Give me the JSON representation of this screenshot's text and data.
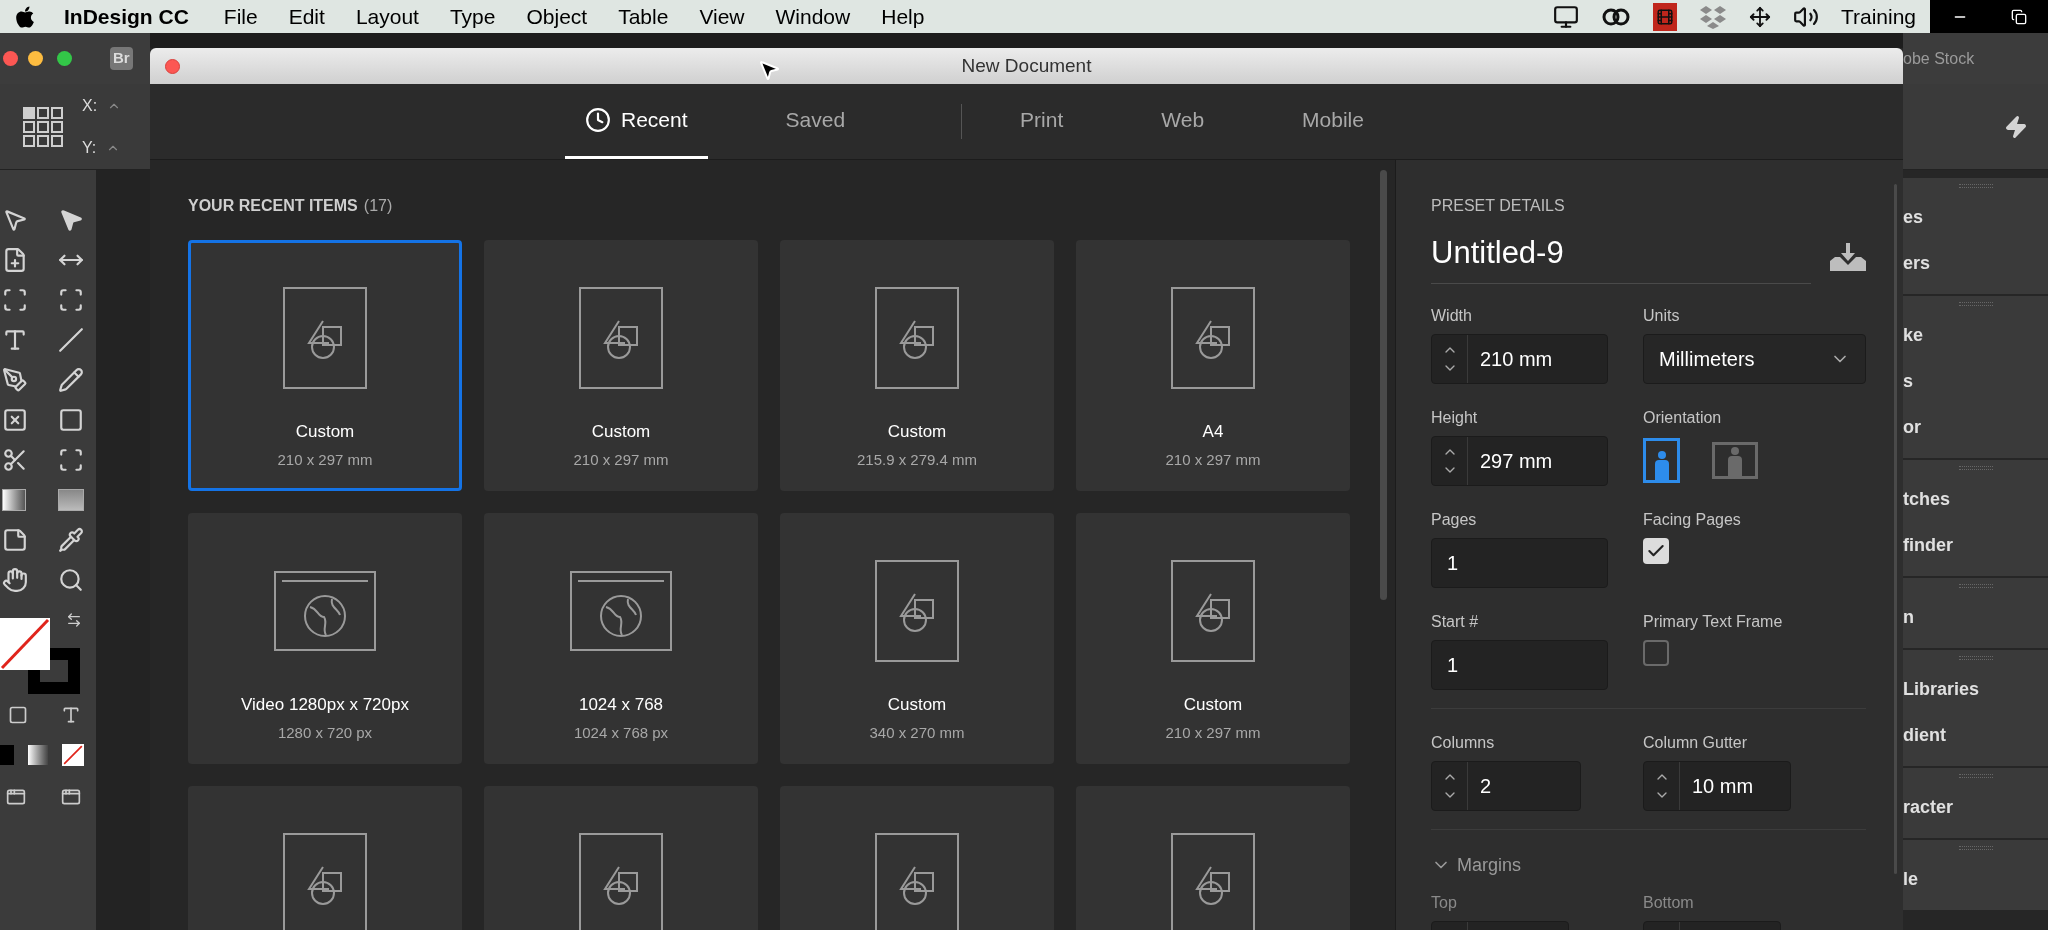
{
  "menu_bar": {
    "app_name": "InDesign CC",
    "menus": [
      "File",
      "Edit",
      "Layout",
      "Type",
      "Object",
      "Table",
      "View",
      "Window",
      "Help"
    ],
    "user": "Training"
  },
  "app_frame": {
    "bridge_button": "Br",
    "x_label": "X:",
    "y_label": "Y:",
    "stock_label": "obe Stock",
    "panel_groups": [
      {
        "items": [
          "es",
          "ers"
        ]
      },
      {
        "items": [
          "ke",
          "s",
          "or"
        ]
      },
      {
        "items": [
          "tches",
          "finder"
        ]
      },
      {
        "items": [
          "n"
        ]
      },
      {
        "items": [
          "Libraries",
          "dient"
        ]
      },
      {
        "items": [
          "racter"
        ]
      },
      {
        "items": [
          "le"
        ]
      }
    ]
  },
  "dialog": {
    "title": "New Document",
    "tabs": [
      {
        "label": "Recent",
        "selected": true
      },
      {
        "label": "Saved",
        "selected": false
      },
      {
        "label": "Print",
        "selected": false
      },
      {
        "label": "Web",
        "selected": false
      },
      {
        "label": "Mobile",
        "selected": false
      }
    ],
    "recent": {
      "heading": "YOUR RECENT ITEMS",
      "count": "(17)",
      "items": [
        {
          "kind": "print",
          "name": "Custom",
          "size": "210 x 297 mm",
          "selected": true
        },
        {
          "kind": "print",
          "name": "Custom",
          "size": "210 x 297 mm",
          "selected": false
        },
        {
          "kind": "print",
          "name": "Custom",
          "size": "215.9 x 279.4 mm",
          "selected": false
        },
        {
          "kind": "print",
          "name": "A4",
          "size": "210 x 297 mm",
          "selected": false
        },
        {
          "kind": "web",
          "name": "Video 1280px x 720px",
          "size": "1280 x 720 px",
          "selected": false
        },
        {
          "kind": "web",
          "name": "1024 x 768",
          "size": "1024 x 768 px",
          "selected": false
        },
        {
          "kind": "print",
          "name": "Custom",
          "size": "340 x 270 mm",
          "selected": false
        },
        {
          "kind": "print",
          "name": "Custom",
          "size": "210 x 297 mm",
          "selected": false
        },
        {
          "kind": "print",
          "selected": false
        },
        {
          "kind": "print",
          "selected": false
        },
        {
          "kind": "print",
          "selected": false
        },
        {
          "kind": "print",
          "selected": false
        }
      ]
    },
    "preset": {
      "heading": "PRESET DETAILS",
      "name": "Untitled-9",
      "width": {
        "label": "Width",
        "value": "210 mm"
      },
      "units": {
        "label": "Units",
        "value": "Millimeters"
      },
      "height": {
        "label": "Height",
        "value": "297 mm"
      },
      "orientation": {
        "label": "Orientation",
        "options": [
          {
            "kind": "portrait",
            "selected": true
          },
          {
            "kind": "landscape",
            "selected": false
          }
        ]
      },
      "pages": {
        "label": "Pages",
        "value": "1"
      },
      "facing_pages": {
        "label": "Facing Pages",
        "checked": true
      },
      "start": {
        "label": "Start #",
        "value": "1"
      },
      "primary_text_frame": {
        "label": "Primary Text Frame",
        "checked": false
      },
      "columns": {
        "label": "Columns",
        "value": "2"
      },
      "column_gutter": {
        "label": "Column Gutter",
        "value": "10 mm"
      },
      "margins": {
        "label": "Margins",
        "expanded": true,
        "fields": [
          {
            "label": "Top"
          },
          {
            "label": "Bottom"
          }
        ]
      }
    }
  }
}
